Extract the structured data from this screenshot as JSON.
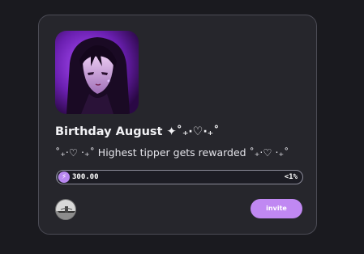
{
  "card": {
    "title": "Birthday August ✦˚₊‧♡‧₊˚",
    "subtitle": "˚₊‧♡ ‧₊˚ Highest tipper gets rewarded ˚₊‧♡ ‧₊˚",
    "progress": {
      "amount": "300.00",
      "percent_label": "<1%",
      "fraction": 0.005,
      "icon": "lightning-icon"
    },
    "invite_label": "invite"
  },
  "colors": {
    "accent": "#c088f2",
    "card_background": "#26262c",
    "page_background": "#1a1a1f"
  }
}
